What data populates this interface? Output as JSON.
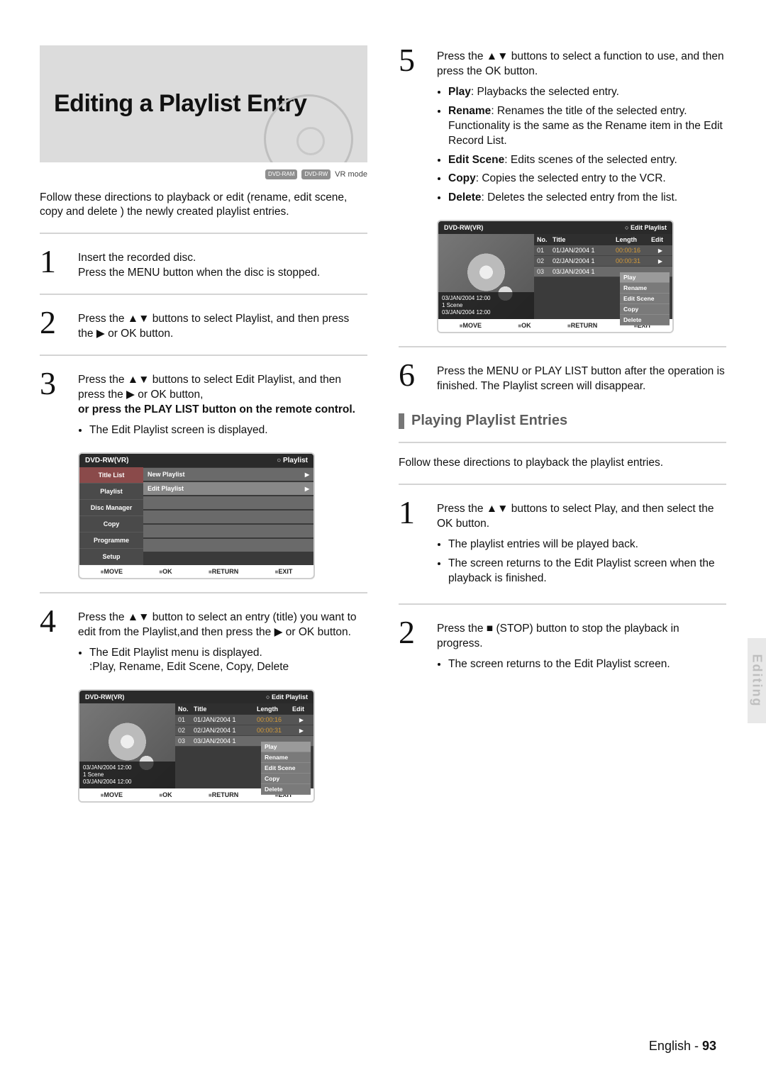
{
  "page": {
    "side_tab": "Editing",
    "footer_lang": "English",
    "footer_sep": " - ",
    "footer_page": "93"
  },
  "title": "Editing a Playlist Entry",
  "mode": {
    "chip1": "DVD-RAM",
    "chip2": "DVD-RW",
    "label": "VR mode"
  },
  "intro": "Follow these directions to playback or edit (rename, edit scene, copy and delete ) the newly created playlist entries.",
  "steps_left": [
    {
      "n": "1",
      "text": "Insert the recorded disc.\nPress the MENU button when the disc is stopped."
    },
    {
      "n": "2",
      "text": "Press the ▲▼ buttons to select Playlist, and then press the ▶ or OK  button."
    },
    {
      "n": "3",
      "text": "Press the ▲▼ buttons to select Edit Playlist, and then press the ▶ or OK  button,",
      "bold": "or press the PLAY LIST button on the remote control.",
      "bullet": "The Edit Playlist screen is displayed."
    },
    {
      "n": "4",
      "text": "Press the ▲▼ button to select an entry (title) you want to edit from the Playlist,and then press the ▶ or OK button.",
      "bullet": "The Edit Playlist menu is displayed.\n:Play, Rename, Edit Scene, Copy, Delete"
    }
  ],
  "step5": {
    "n": "5",
    "text": "Press the ▲▼ buttons to select a function to use, and then press the OK button.",
    "items": [
      {
        "b": "Play",
        "t": ": Playbacks the selected entry."
      },
      {
        "b": "Rename",
        "t": ": Renames the title of the selected entry. Functionality is the same as the Rename item in the Edit Record List."
      },
      {
        "b": "Edit Scene",
        "t": ": Edits scenes of the selected entry."
      },
      {
        "b": "Copy",
        "t": ": Copies the selected entry to the VCR."
      },
      {
        "b": "Delete",
        "t": ": Deletes the selected entry from the list."
      }
    ]
  },
  "step6": {
    "n": "6",
    "text": "Press the MENU or PLAY LIST button after the operation is finished. The Playlist screen will disappear."
  },
  "section2": {
    "heading": "Playing Playlist Entries",
    "intro": "Follow these directions to playback the playlist entries.",
    "steps": [
      {
        "n": "1",
        "text": "Press the ▲▼ buttons to select Play, and then select the OK button.",
        "bullets": [
          "The playlist entries will be played back.",
          "The screen returns to the Edit Playlist screen when the playback is finished."
        ]
      },
      {
        "n": "2",
        "text": "Press the ■ (STOP) button to stop the playback in progress.",
        "bullets": [
          "The screen returns to the Edit Playlist screen."
        ]
      }
    ]
  },
  "osd_playlist": {
    "left": "DVD-RW(VR)",
    "right": "Playlist",
    "menu": [
      "Title List",
      "Playlist",
      "Disc Manager",
      "Copy",
      "Programme",
      "Setup"
    ],
    "lines": [
      "New Playlist",
      "Edit Playlist"
    ],
    "footer": [
      "MOVE",
      "OK",
      "RETURN",
      "EXIT"
    ]
  },
  "osd_edit": {
    "left": "DVD-RW(VR)",
    "right": "Edit Playlist",
    "meta": {
      "l1": "03/JAN/2004 12:00",
      "l2": "1 Scene",
      "l3": "03/JAN/2004 12:00"
    },
    "cols": {
      "no": "No.",
      "title": "Title",
      "length": "Length",
      "edit": "Edit"
    },
    "rows": [
      {
        "no": "01",
        "title": "01/JAN/2004 1",
        "length": "00:00:16"
      },
      {
        "no": "02",
        "title": "02/JAN/2004 1",
        "length": "00:00:31"
      },
      {
        "no": "03",
        "title": "03/JAN/2004 1",
        "length": ""
      }
    ],
    "ctx": [
      "Play",
      "Rename",
      "Edit Scene",
      "Copy",
      "Delete"
    ],
    "footer": [
      "MOVE",
      "OK",
      "RETURN",
      "EXIT"
    ]
  }
}
